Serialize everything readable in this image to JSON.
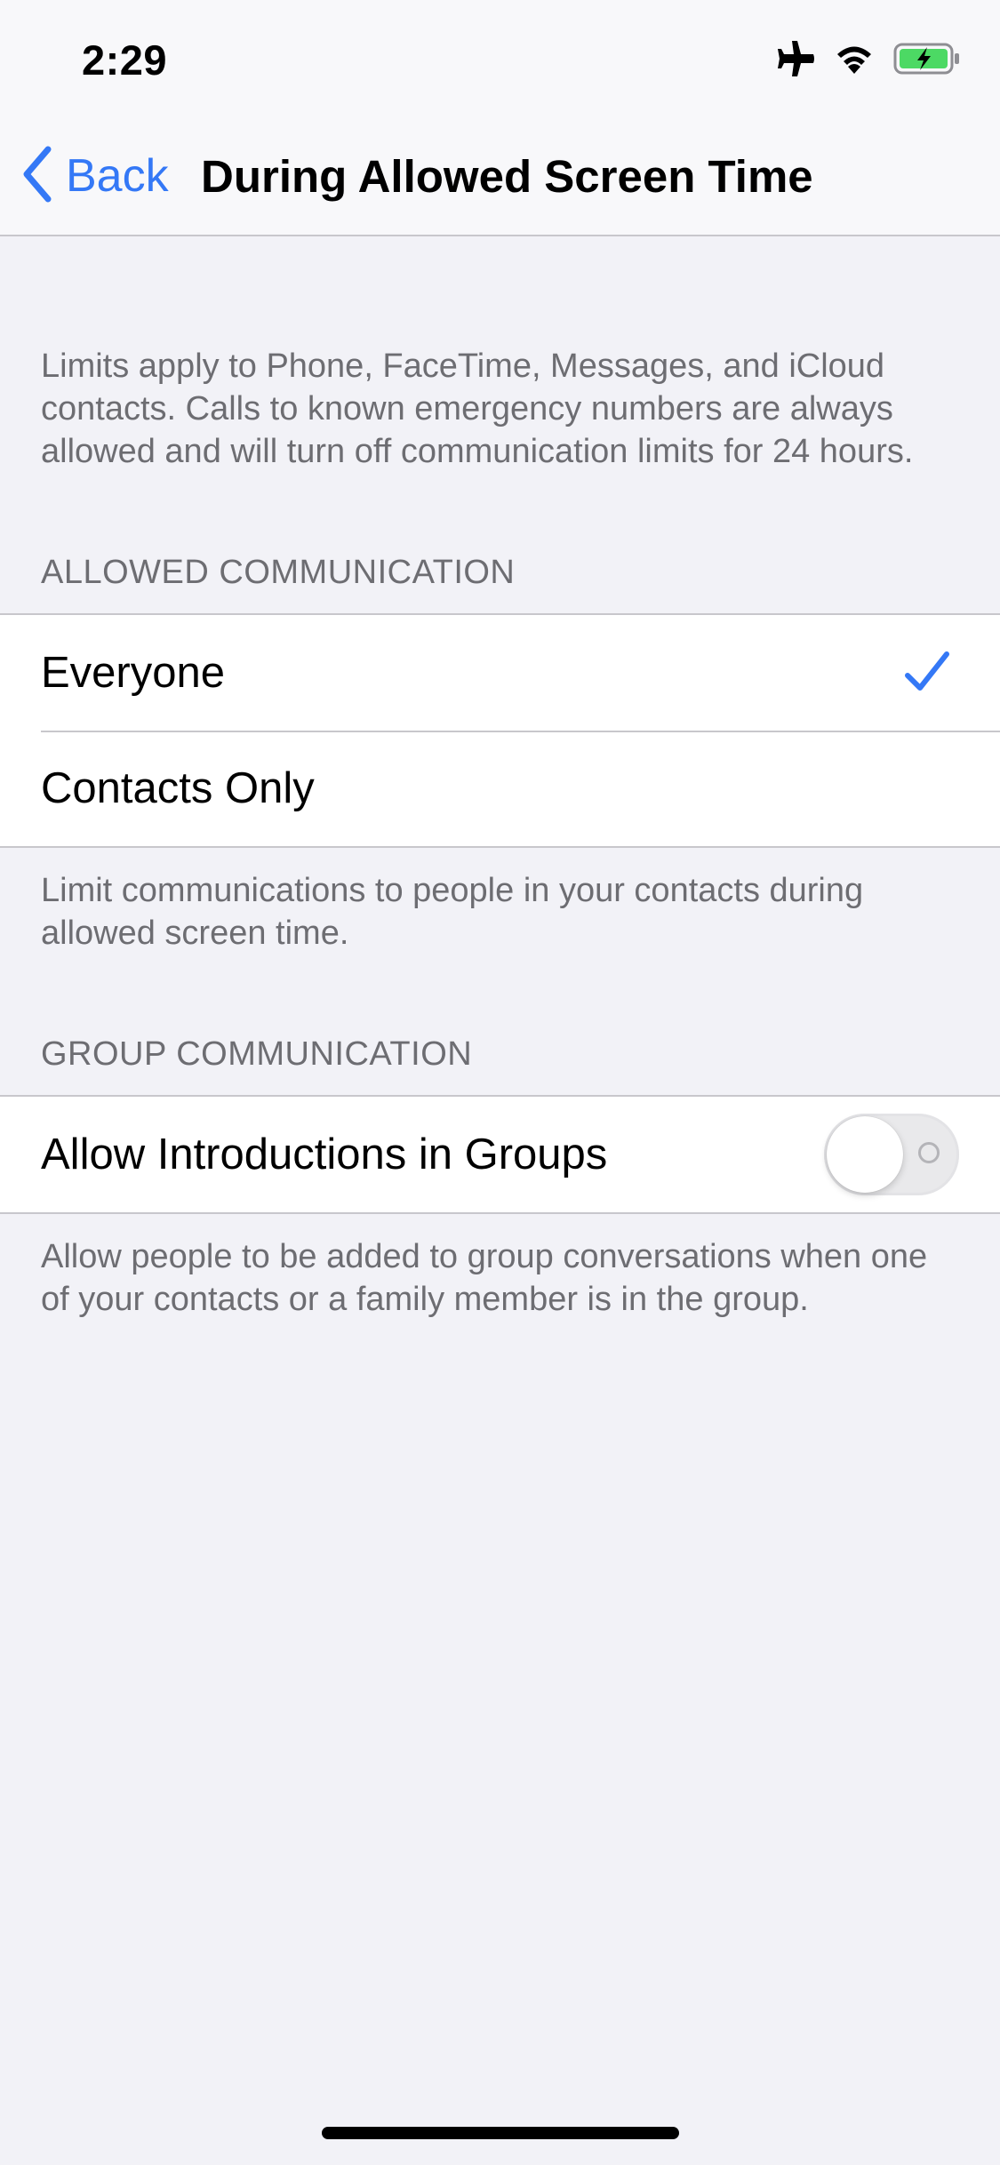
{
  "status_bar": {
    "time": "2:29",
    "icons": [
      "airplane-mode-icon",
      "wifi-icon",
      "battery-charging-icon"
    ],
    "battery_color": "#4cd964"
  },
  "nav": {
    "back_label": "Back",
    "title": "During Allowed Screen Time"
  },
  "intro_text": "Limits apply to Phone, FaceTime, Messages, and iCloud contacts. Calls to known emergency numbers are always allowed and will turn off communication limits for 24 hours.",
  "allowed_communication": {
    "header": "ALLOWED COMMUNICATION",
    "options": [
      {
        "label": "Everyone",
        "selected": true
      },
      {
        "label": "Contacts Only",
        "selected": false
      }
    ],
    "footer": "Limit communications to people in your contacts during allowed screen time."
  },
  "group_communication": {
    "header": "GROUP COMMUNICATION",
    "toggle_label": "Allow Introductions in Groups",
    "toggle_on": false,
    "footer": "Allow people to be added to group conversations when one of your contacts or a family member is in the group."
  },
  "colors": {
    "accent": "#3478f6",
    "background": "#f2f2f7",
    "secondary_text": "#6d6d72",
    "separator": "#c8c7cc"
  }
}
